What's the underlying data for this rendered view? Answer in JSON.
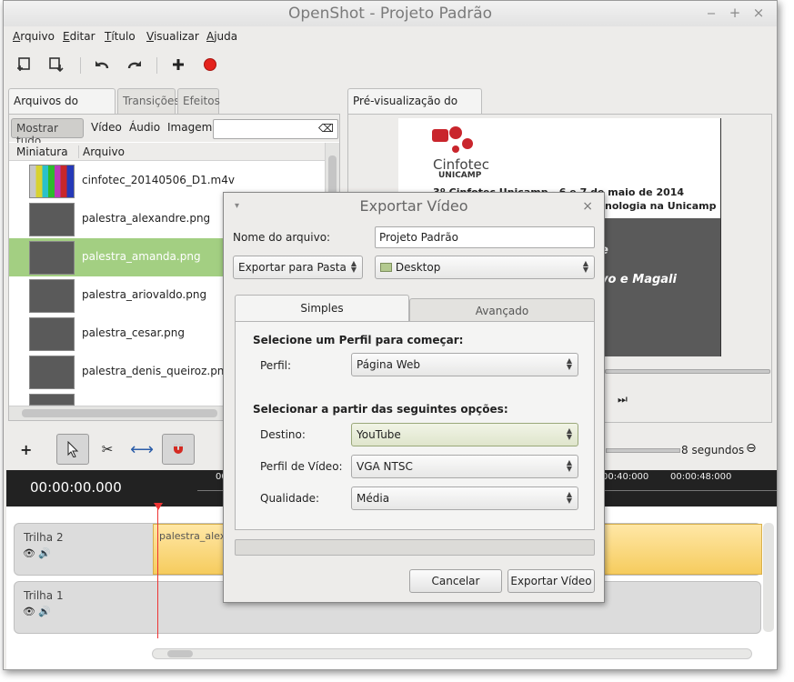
{
  "window": {
    "title": "OpenShot - Projeto Padrão"
  },
  "menu": [
    "Arquivo",
    "Editar",
    "Título",
    "Visualizar",
    "Ajuda"
  ],
  "left_tabs": [
    "Arquivos do Projeto",
    "Transições",
    "Efeitos"
  ],
  "filters": [
    "Mostrar tudo",
    "Vídeo",
    "Áudio",
    "Imagem"
  ],
  "columns": {
    "thumb": "Miniatura",
    "file": "Arquivo"
  },
  "files": [
    {
      "name": "cinfotec_20140506_D1.m4v"
    },
    {
      "name": "palestra_alexandre.png"
    },
    {
      "name": "palestra_amanda.png"
    },
    {
      "name": "palestra_ariovaldo.png"
    },
    {
      "name": "palestra_cesar.png"
    },
    {
      "name": "palestra_denis_queiroz.png"
    }
  ],
  "preview": {
    "tab": "Pré-visualização do vídeo",
    "logo_line1": "Cinfotec",
    "logo_line2": "UNICAMP",
    "headline": "3º Cinfotec Unicamp - 6 e 7 de maio de 2014",
    "subline": "nologia na Unicamp",
    "text_e": "e",
    "text_names": "yo e Magali"
  },
  "timeline": {
    "time": "00:00:00.000",
    "zoom_label": "8 segundos",
    "ruler_marks": [
      "00",
      "00:40:000",
      "00:00:48:000"
    ],
    "tracks": [
      {
        "name": "Trilha 2",
        "clip": "palestra_alex"
      },
      {
        "name": "Trilha 1",
        "clip": ""
      }
    ]
  },
  "dialog": {
    "title": "Exportar Vídeo",
    "filename_label": "Nome do arquivo:",
    "filename_value": "Projeto Padrão",
    "folder_combo": "Exportar para Pasta",
    "folder_value": "Desktop",
    "tabs": [
      "Simples",
      "Avançado"
    ],
    "profile_heading": "Selecione um Perfil para começar:",
    "profile_label": "Perfil:",
    "profile_value": "Página Web",
    "options_heading": "Selecionar a partir das seguintes opções:",
    "target_label": "Destino:",
    "target_value": "YouTube",
    "video_profile_label": "Perfil de Vídeo:",
    "video_profile_value": "VGA NTSC",
    "quality_label": "Qualidade:",
    "quality_value": "Média",
    "cancel": "Cancelar",
    "export": "Exportar Vídeo"
  }
}
